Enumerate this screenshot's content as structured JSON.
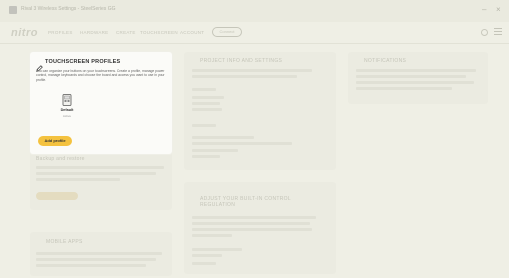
{
  "titlebar": {
    "title": "Rival 3 Wireless Settings - SteelSeries GG"
  },
  "app": {
    "logo": "nitro"
  },
  "nav": {
    "items": [
      "PROFILES",
      "HARDWARE",
      "CREATE",
      "TOUCHSCREEN",
      "ACCOUNT"
    ],
    "pill_label": "Connect"
  },
  "profiles_card": {
    "title": "TOUCHSCREEN PROFILES",
    "description": "You can organize your buttons on your touchscreens. Create a profile, manage power control, manage keyboards and choose the board and access you want to use in your profile.",
    "profile": {
      "name": "Default",
      "meta": "Active"
    },
    "add_button": "Add profile"
  },
  "ghost": {
    "project_title": "PROJECT INFO AND SETTINGS",
    "notifications_title": "NOTIFICATIONS",
    "backup_title": "Backup and restore",
    "adjust_title": "ADJUST YOUR BUILT-IN CONTROL REGULATION",
    "mobile_title": "MOBILE APPS"
  },
  "colors": {
    "accent": "#f4c23f",
    "background": "#efefe5",
    "card": "#fbfbf8"
  }
}
